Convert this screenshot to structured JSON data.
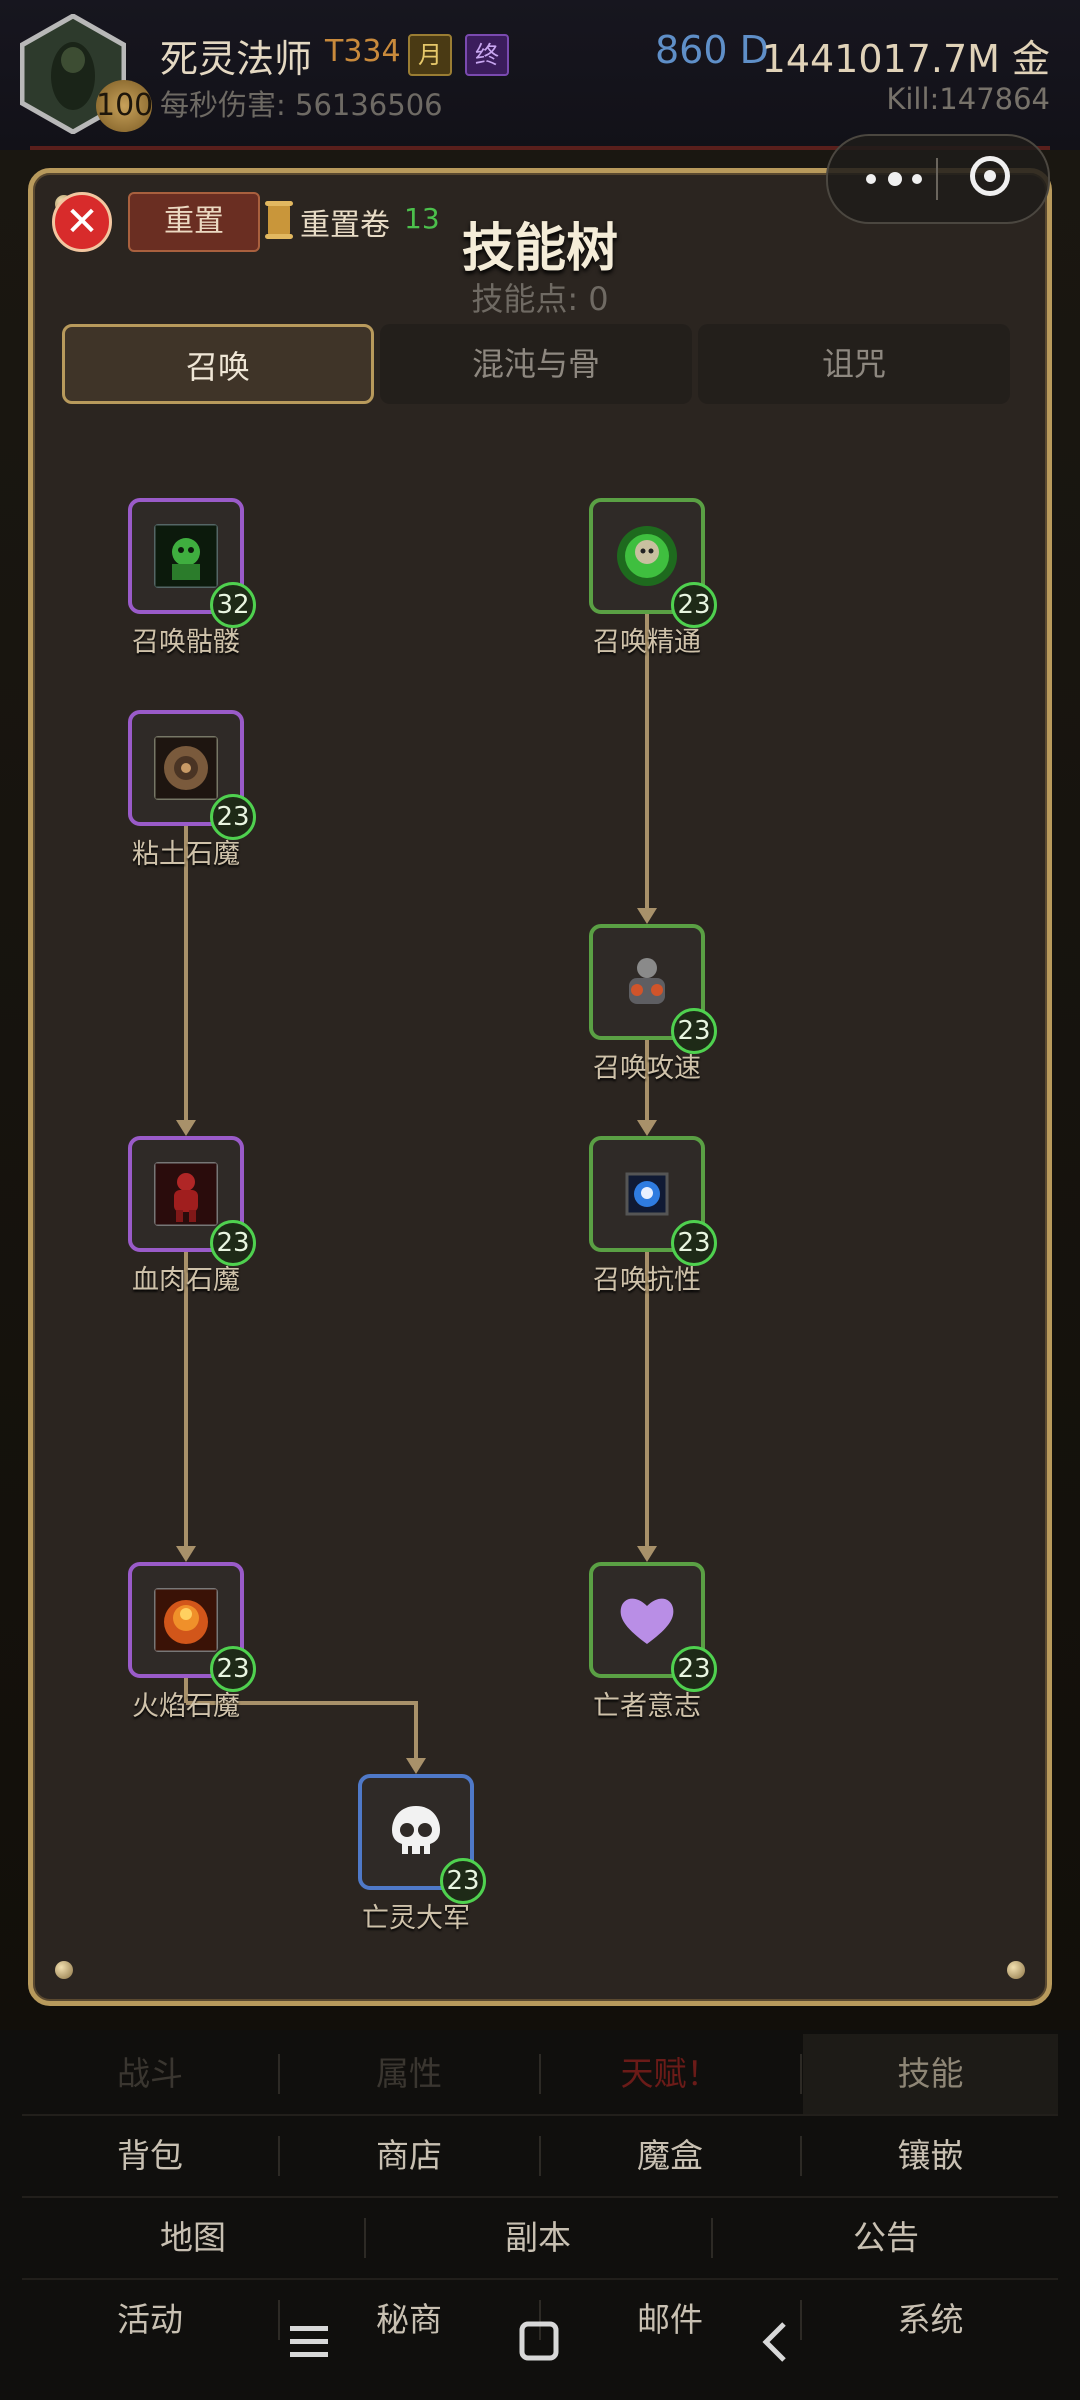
{
  "header": {
    "player_name": "死灵法师",
    "tier": "T334",
    "tag_month": "月",
    "tag_end": "终",
    "level": "100",
    "dps": "每秒伤害: 56136506",
    "diamonds": "860 D",
    "gold": "1441017.7M 金",
    "kills": "Kill:147864"
  },
  "skill_panel": {
    "reset_label": "重置",
    "reset_scroll_label": "重置卷",
    "reset_scroll_count": "13",
    "title": "技能树",
    "skill_points": "技能点: 0",
    "tabs": [
      {
        "label": "召唤",
        "active": true
      },
      {
        "label": "混沌与骨",
        "active": false
      },
      {
        "label": "诅咒",
        "active": false
      }
    ],
    "skills": [
      {
        "name": "召唤骷髅",
        "level": "32",
        "color": "purple",
        "icon": "skeleton-icon"
      },
      {
        "name": "粘土石魔",
        "level": "23",
        "color": "purple",
        "icon": "clay-golem-icon"
      },
      {
        "name": "血肉石魔",
        "level": "23",
        "color": "purple",
        "icon": "blood-golem-icon"
      },
      {
        "name": "火焰石魔",
        "level": "23",
        "color": "purple",
        "icon": "fire-golem-icon"
      },
      {
        "name": "召唤精通",
        "level": "23",
        "color": "green",
        "icon": "summon-mastery-icon"
      },
      {
        "name": "召唤攻速",
        "level": "23",
        "color": "green",
        "icon": "summon-speed-icon"
      },
      {
        "name": "召唤抗性",
        "level": "23",
        "color": "green",
        "icon": "summon-resist-icon"
      },
      {
        "name": "亡者意志",
        "level": "23",
        "color": "green",
        "icon": "heart-icon"
      },
      {
        "name": "亡灵大军",
        "level": "23",
        "color": "blue",
        "icon": "skull-icon"
      }
    ]
  },
  "menu": {
    "row1": [
      "战斗",
      "属性",
      "天赋！",
      "技能"
    ],
    "row2": [
      "背包",
      "商店",
      "魔盒",
      "镶嵌"
    ],
    "row3": [
      "地图",
      "副本",
      "公告"
    ],
    "row4": [
      "活动",
      "秘商",
      "邮件",
      "系统"
    ]
  }
}
